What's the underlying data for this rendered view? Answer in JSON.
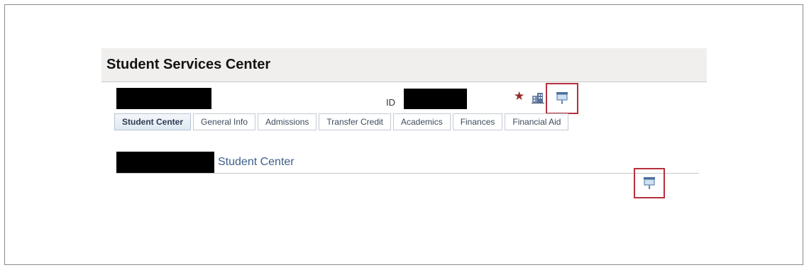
{
  "header": {
    "title": "Student Services Center"
  },
  "student_info": {
    "id_label": "ID"
  },
  "icons": {
    "favorite": "star-icon",
    "institution": "building-icon",
    "presentation": "presentation-icon"
  },
  "tabs": [
    {
      "label": "Student Center",
      "active": true
    },
    {
      "label": "General Info",
      "active": false
    },
    {
      "label": "Admissions",
      "active": false
    },
    {
      "label": "Transfer Credit",
      "active": false
    },
    {
      "label": "Academics",
      "active": false
    },
    {
      "label": "Finances",
      "active": false
    },
    {
      "label": "Financial Aid",
      "active": false
    }
  ],
  "section": {
    "title": "Student Center"
  },
  "colors": {
    "highlight": "#b5303c",
    "link_blue": "#3e5f8a",
    "star": "#9a2a2a",
    "header_bg": "#f0efed"
  }
}
